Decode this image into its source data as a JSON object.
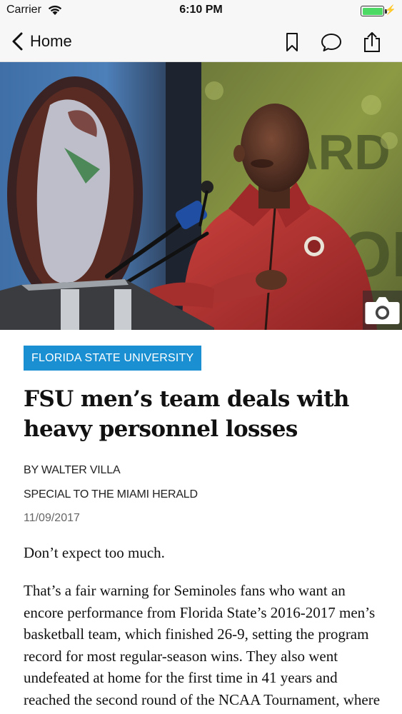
{
  "status_bar": {
    "carrier": "Carrier",
    "time": "6:10 PM",
    "battery_level": 1.0
  },
  "nav": {
    "back_label": "Home",
    "icons": [
      "bookmark-icon",
      "comment-icon",
      "share-icon"
    ]
  },
  "hero": {
    "icon": "camera-icon"
  },
  "article": {
    "section": "FLORIDA STATE UNIVERSITY",
    "headline": "FSU men’s team deals with heavy personnel losses",
    "byline": "BY WALTER VILLA",
    "affiliation": "SPECIAL TO THE MIAMI HERALD",
    "date": "11/09/2017",
    "lede": "Don’t expect too much.",
    "body": "That’s a fair warning for Seminoles fans who want an encore performance from Florida State’s 2016-2017 men’s basketball team, which finished 26-9, setting the program record for most regular-season wins. They also went undefeated at home for the first time in 41 years and reached the second round of the NCAA Tournament, where"
  },
  "colors": {
    "accent": "#1a8fd1",
    "jacket": "#b4302e",
    "battery": "#4cd964"
  }
}
